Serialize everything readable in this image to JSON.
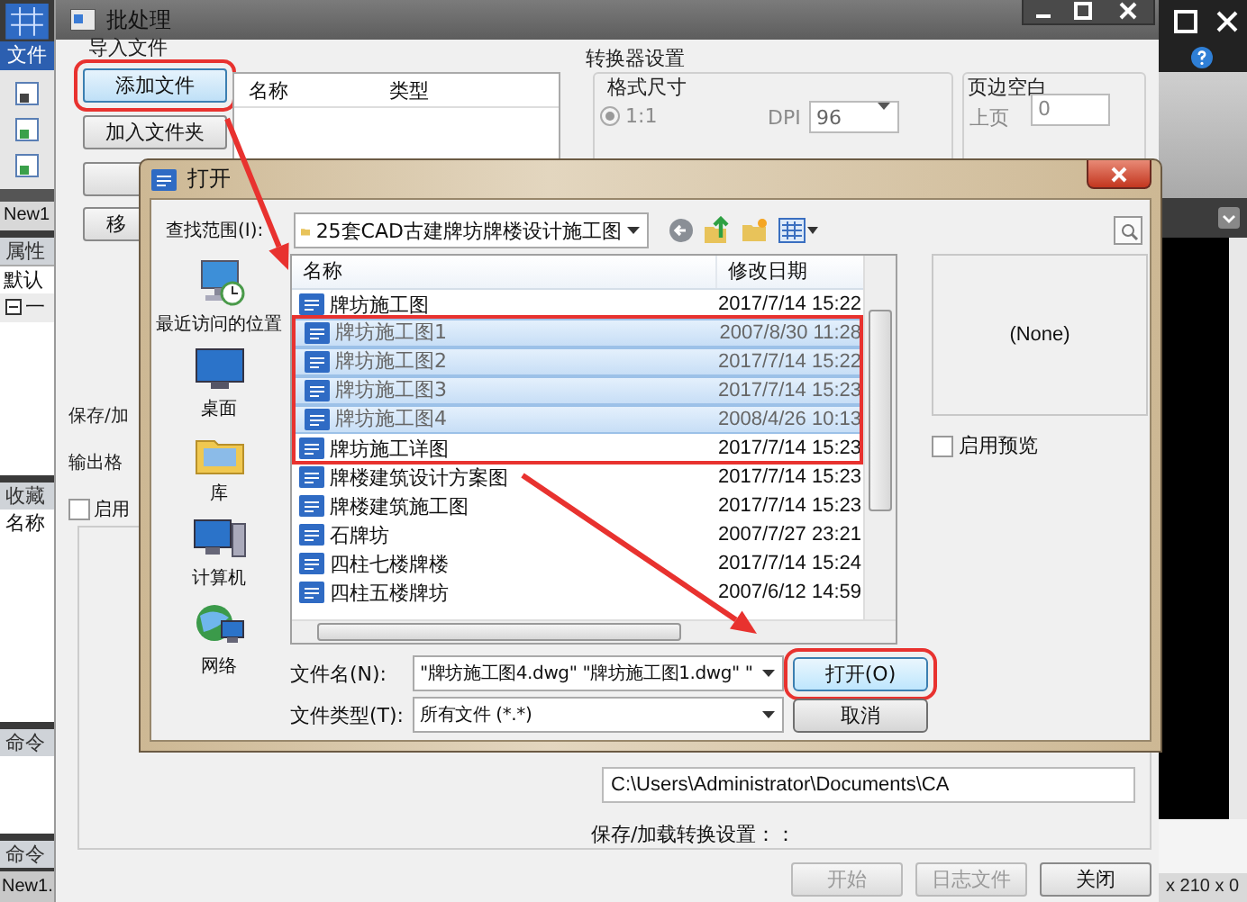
{
  "app": {
    "menu_label": "文件",
    "doc_tab": "New1",
    "properties_tab": "属性",
    "default_field": "默认",
    "tree_node": "一",
    "favorites_tab": "收藏",
    "name_header": "名称",
    "command_tabs": [
      "命令",
      "命令"
    ],
    "bottom_tab": "New1.",
    "status_text": "x 210 x 0"
  },
  "batch_dialog": {
    "title": "批处理",
    "import_label": "导入文件",
    "add_buttons": [
      {
        "label": "添加文件",
        "highlighted": true
      },
      {
        "label": "加入文件夹",
        "highlighted": false
      }
    ],
    "remove_button": "移",
    "file_columns": [
      "名称",
      "类型"
    ],
    "converter_label": "转换器设置",
    "format_group": "格式尺寸",
    "ratio_option": {
      "label": "1:1",
      "selected": true
    },
    "dpi_label": "DPI",
    "dpi_value": "96",
    "margin_group": "页边空白",
    "top_margin_label": "上页",
    "top_margin_value": "0",
    "save_label": "保存/加",
    "output_label": "输出格",
    "enable_checkbox": {
      "label": "启用",
      "checked": false
    },
    "path_value": "C:\\Users\\Administrator\\Documents\\CA",
    "settings_label": "保存/加载转换设置：：",
    "footer_buttons": [
      {
        "label": "开始",
        "disabled": true
      },
      {
        "label": "日志文件",
        "disabled": true
      },
      {
        "label": "关闭",
        "disabled": false
      }
    ]
  },
  "open_dialog": {
    "title": "打开",
    "look_in_label": "查找范围(I):",
    "look_in_value": "25套CAD古建牌坊牌楼设计施工图",
    "places": [
      {
        "label": "最近访问的位置",
        "kind": "recent"
      },
      {
        "label": "桌面",
        "kind": "desktop"
      },
      {
        "label": "库",
        "kind": "library"
      },
      {
        "label": "计算机",
        "kind": "computer"
      },
      {
        "label": "网络",
        "kind": "network"
      }
    ],
    "columns": [
      "名称",
      "修改日期"
    ],
    "files": [
      {
        "name": "牌坊施工图",
        "modified": "2017/7/14 15:22",
        "selected": false,
        "highlighted": false
      },
      {
        "name": "牌坊施工图1",
        "modified": "2007/8/30 11:28",
        "selected": true,
        "highlighted": true
      },
      {
        "name": "牌坊施工图2",
        "modified": "2017/7/14 15:22",
        "selected": true,
        "highlighted": true
      },
      {
        "name": "牌坊施工图3",
        "modified": "2017/7/14 15:23",
        "selected": true,
        "highlighted": true
      },
      {
        "name": "牌坊施工图4",
        "modified": "2008/4/26 10:13",
        "selected": true,
        "highlighted": true
      },
      {
        "name": "牌坊施工详图",
        "modified": "2017/7/14 15:23",
        "selected": false,
        "highlighted": true
      },
      {
        "name": "牌楼建筑设计方案图",
        "modified": "2017/7/14 15:23",
        "selected": false,
        "highlighted": false
      },
      {
        "name": "牌楼建筑施工图",
        "modified": "2017/7/14 15:23",
        "selected": false,
        "highlighted": false
      },
      {
        "name": "石牌坊",
        "modified": "2007/7/27 23:21",
        "selected": false,
        "highlighted": false
      },
      {
        "name": "四柱七楼牌楼",
        "modified": "2017/7/14 15:24",
        "selected": false,
        "highlighted": false
      },
      {
        "name": "四柱五楼牌坊",
        "modified": "2007/6/12 14:59",
        "selected": false,
        "highlighted": false
      }
    ],
    "preview_text": "(None)",
    "preview_checkbox": {
      "label": "启用预览",
      "checked": false
    },
    "file_name_label": "文件名(N):",
    "file_name_value": "\"牌坊施工图4.dwg\" \"牌坊施工图1.dwg\" \"",
    "file_type_label": "文件类型(T):",
    "file_type_value": "所有文件 (*.*)",
    "buttons": [
      {
        "label": "打开(O)",
        "highlighted": true
      },
      {
        "label": "取消",
        "highlighted": false
      }
    ]
  }
}
